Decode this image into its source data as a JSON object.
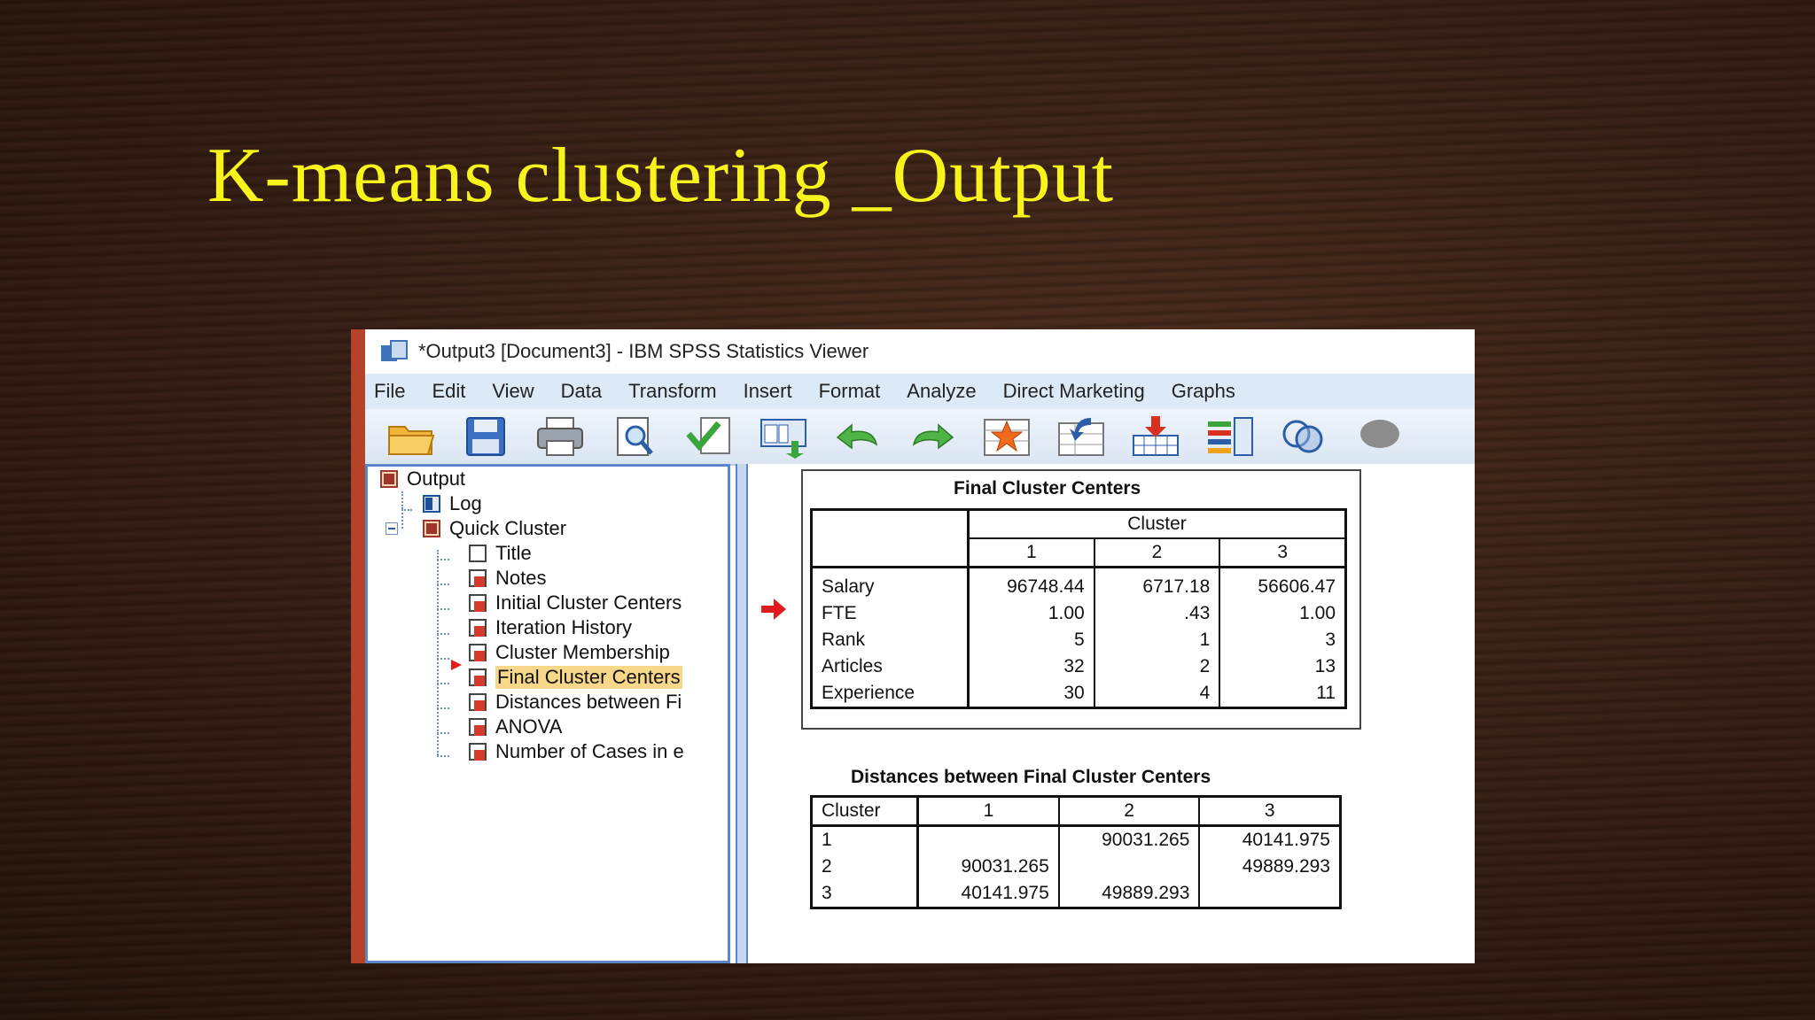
{
  "slide": {
    "title": "K-means clustering _Output"
  },
  "window": {
    "title": "*Output3 [Document3] - IBM SPSS Statistics Viewer"
  },
  "menu": [
    "File",
    "Edit",
    "View",
    "Data",
    "Transform",
    "Insert",
    "Format",
    "Analyze",
    "Direct Marketing",
    "Graphs"
  ],
  "toolbar": [
    "open-icon",
    "save-icon",
    "print-icon",
    "print-preview-icon",
    "export-icon",
    "recall-dialog-icon",
    "undo-icon",
    "redo-icon",
    "goto-data-icon",
    "goto-case-icon",
    "insert-variable-icon",
    "split-file-icon",
    "venn-icon",
    "chat-icon"
  ],
  "nav_tree": {
    "root": "Output",
    "log": "Log",
    "group": "Quick Cluster",
    "items": [
      "Title",
      "Notes",
      "Initial Cluster Centers",
      "Iteration History",
      "Cluster Membership",
      "Final Cluster Centers",
      "Distances between Fi",
      "ANOVA",
      "Number of Cases in e"
    ],
    "selected": "Final Cluster Centers"
  },
  "final_cluster_centers": {
    "title": "Final Cluster Centers",
    "group_header": "Cluster",
    "columns": [
      "1",
      "2",
      "3"
    ],
    "rows": [
      {
        "label": "Salary",
        "values": [
          "96748.44",
          "6717.18",
          "56606.47"
        ]
      },
      {
        "label": "FTE",
        "values": [
          "1.00",
          ".43",
          "1.00"
        ]
      },
      {
        "label": "Rank",
        "values": [
          "5",
          "1",
          "3"
        ]
      },
      {
        "label": "Articles",
        "values": [
          "32",
          "2",
          "13"
        ]
      },
      {
        "label": "Experience",
        "values": [
          "30",
          "4",
          "11"
        ]
      }
    ]
  },
  "distances": {
    "title": "Distances between Final Cluster Centers",
    "corner": "Cluster",
    "columns": [
      "1",
      "2",
      "3"
    ],
    "rows": [
      {
        "label": "1",
        "values": [
          "",
          "90031.265",
          "40141.975"
        ]
      },
      {
        "label": "2",
        "values": [
          "90031.265",
          "",
          "49889.293"
        ]
      },
      {
        "label": "3",
        "values": [
          "40141.975",
          "49889.293",
          ""
        ]
      }
    ]
  }
}
